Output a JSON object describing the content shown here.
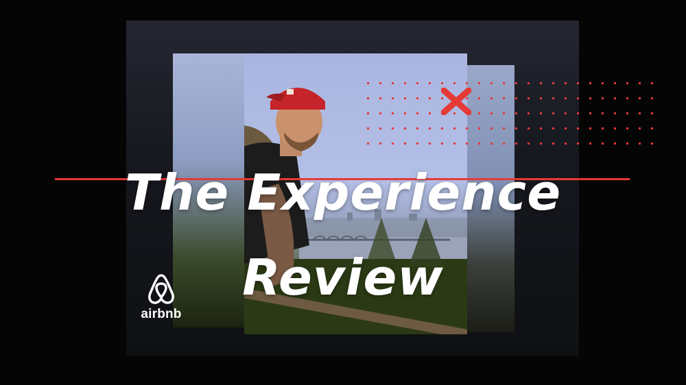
{
  "title": {
    "line1": "The Experience",
    "line2": "Review"
  },
  "brand": {
    "name": "airbnb",
    "logo_icon": "airbnb-belo-icon"
  },
  "colors": {
    "accent_red": "#e53a36",
    "background": "#050505",
    "text": "#ffffff"
  },
  "decorations": {
    "x_mark_icon": "x-mark-icon",
    "dot_grid_icon": "dot-grid-pattern"
  }
}
